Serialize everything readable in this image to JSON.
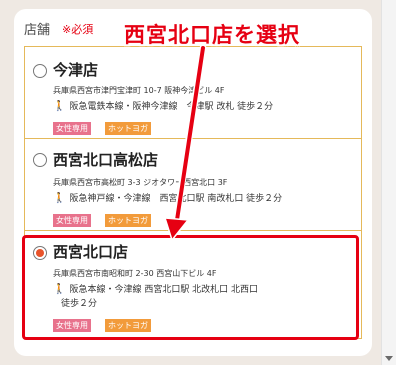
{
  "form": {
    "section_title": "店舗",
    "required_label": "※必須"
  },
  "annotation": {
    "text": "西宮北口店を選択",
    "color": "#e60012"
  },
  "stores": [
    {
      "name": "今津店",
      "address": "兵庫県西宮市津門宝津町 10-7 阪神今津ビル 4F",
      "access": "阪急電鉄本線・阪神今津線　今津駅 改札 徒歩２分",
      "access_line2": "",
      "badges": [
        "女性専用",
        "ホットヨガ"
      ],
      "selected": false
    },
    {
      "name": "西宮北口高松店",
      "address": "兵庫県西宮市高松町 3-3 ジオタワー西宮北口 3F",
      "access": "阪急神戸線・今津線　西宮北口駅 南改札口 徒歩２分",
      "access_line2": "",
      "badges": [
        "女性専用",
        "ホットヨガ"
      ],
      "selected": false
    },
    {
      "name": "西宮北口店",
      "address": "兵庫県西宮市南昭和町 2-30 西宮山下ビル 4F",
      "access": "阪急本線・今津線 西宮北口駅 北改札口 北西口",
      "access_line2": "徒歩２分",
      "badges": [
        "女性専用",
        "ホットヨガ"
      ],
      "selected": true
    }
  ],
  "icons": {
    "walk": "walking-person-icon",
    "arrow": "red-arrow-icon"
  },
  "colors": {
    "accent_red": "#e60012",
    "border_gold": "#e5b95a",
    "badge_pink": "#e8728c",
    "badge_orange": "#f29b3b",
    "walk_orange": "#f08c00"
  }
}
